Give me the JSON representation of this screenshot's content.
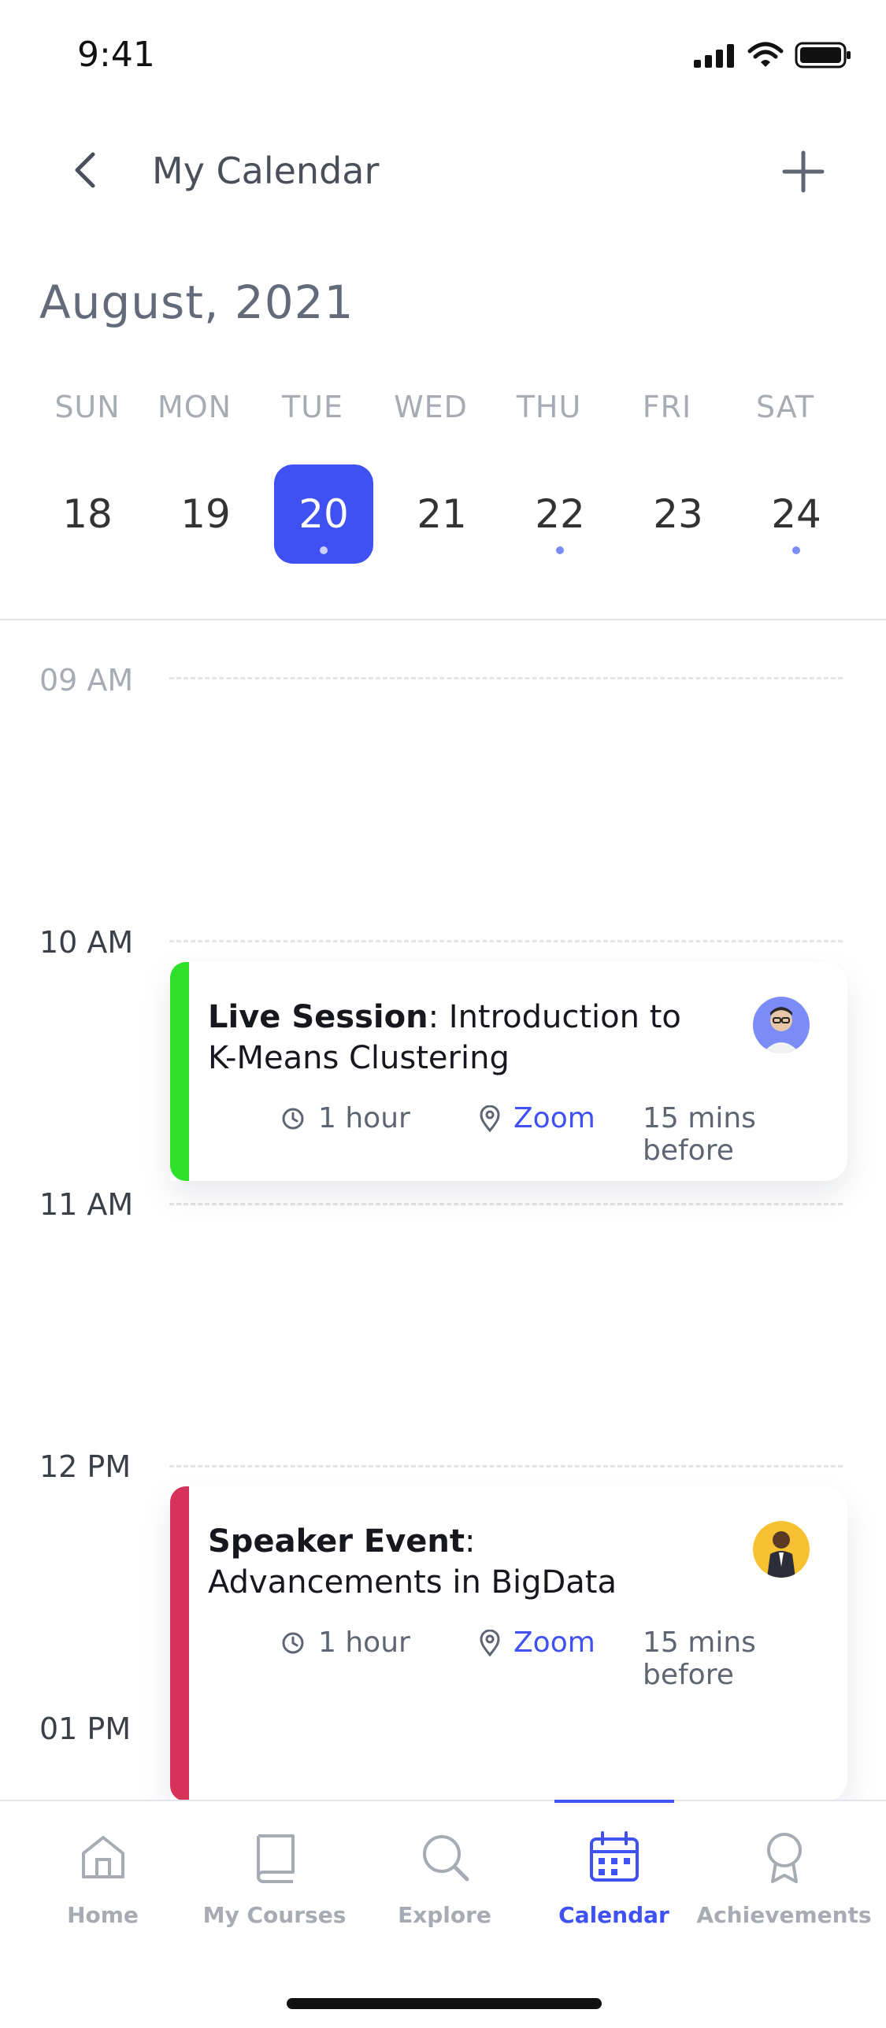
{
  "status_bar": {
    "time": "9:41"
  },
  "header": {
    "title": "My Calendar"
  },
  "calendar": {
    "month_label": "August, 2021",
    "weekdays": [
      "SUN",
      "MON",
      "TUE",
      "WED",
      "THU",
      "FRI",
      "SAT"
    ],
    "days": [
      "18",
      "19",
      "20",
      "21",
      "22",
      "23",
      "24"
    ],
    "selected_day": "20",
    "days_with_events": [
      "20",
      "22",
      "24"
    ]
  },
  "timeline": {
    "hours": [
      "09 AM",
      "10 AM",
      "11 AM",
      "12 PM",
      "01 PM"
    ]
  },
  "events": [
    {
      "type": "Live Session",
      "separator": ": ",
      "name": "Introduction to K-Means Clustering",
      "duration": "1 hour",
      "location": "Zoom",
      "reminder": "15 mins before",
      "color": "#2fe02a",
      "avatar_icon": "person-glasses-avatar"
    },
    {
      "type": "Speaker Event",
      "separator": ": ",
      "name": "Advancements in BigData",
      "duration": "1 hour",
      "location": "Zoom",
      "reminder": "15 mins before",
      "color": "#d6335a",
      "avatar_icon": "person-suit-avatar"
    }
  ],
  "bottom_nav": {
    "tabs": [
      {
        "label": "Home",
        "icon": "home-icon"
      },
      {
        "label": "My Courses",
        "icon": "book-icon"
      },
      {
        "label": "Explore",
        "icon": "search-icon"
      },
      {
        "label": "Calendar",
        "icon": "calendar-icon"
      },
      {
        "label": "Achievements",
        "icon": "award-icon"
      }
    ],
    "active": "Calendar"
  },
  "colors": {
    "accent": "#3f51f3",
    "muted": "#a7acb4"
  }
}
